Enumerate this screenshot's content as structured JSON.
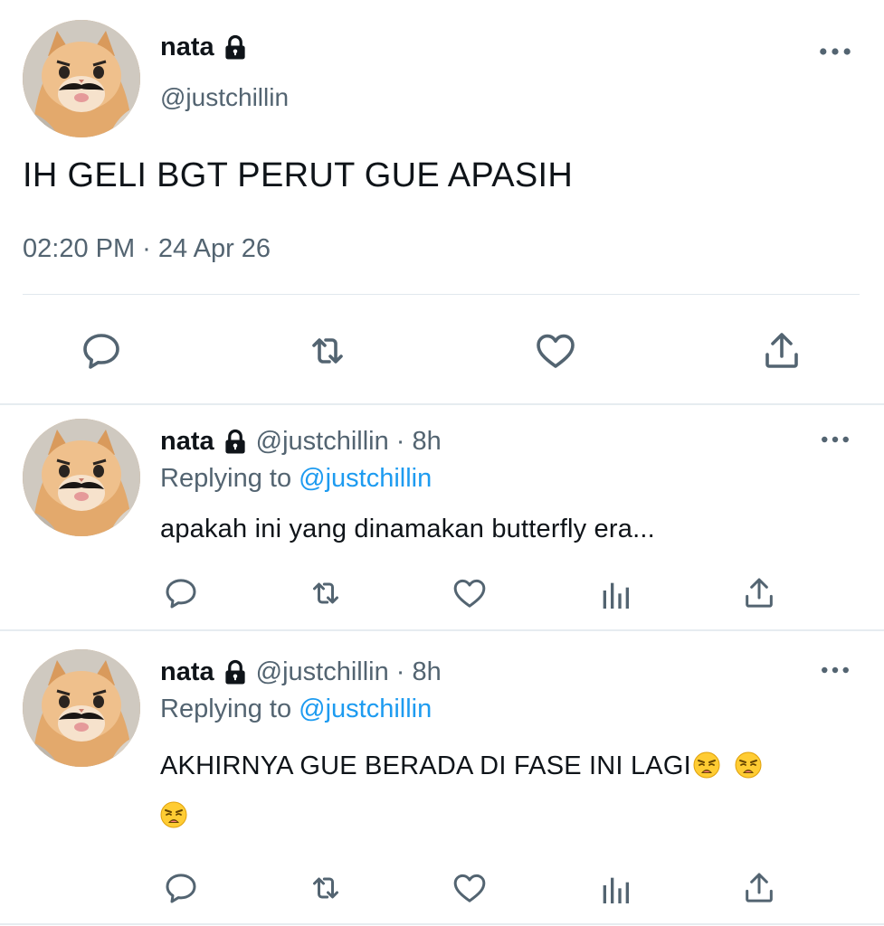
{
  "main_tweet": {
    "name": "nata",
    "handle": "@justchillin",
    "text": "IH GELI BGT PERUT GUE APASIH",
    "timestamp": "02:20 PM · 24 Apr 26",
    "actions": [
      "reply-icon",
      "retweet-icon",
      "like-icon",
      "share-icon"
    ]
  },
  "replies": [
    {
      "name": "nata",
      "handle_time": "@justchillin · 8h",
      "replying_prefix": "Replying to",
      "replying_mention": "@justchillin",
      "text": "apakah ini yang dinamakan butterfly era...",
      "emojis": []
    },
    {
      "name": "nata",
      "handle_time": "@justchillin · 8h",
      "replying_prefix": "Replying to",
      "replying_mention": "@justchillin",
      "text": "AKHIRNYA GUE BERADA DI FASE INI LAGI",
      "emojis": [
        "weary-face-emoji",
        "weary-face-emoji",
        "weary-face-emoji"
      ]
    }
  ],
  "colors": {
    "text": "#0f1419",
    "secondary": "#536471",
    "link": "#1d9bf0",
    "divider": "#e1e8ed"
  }
}
